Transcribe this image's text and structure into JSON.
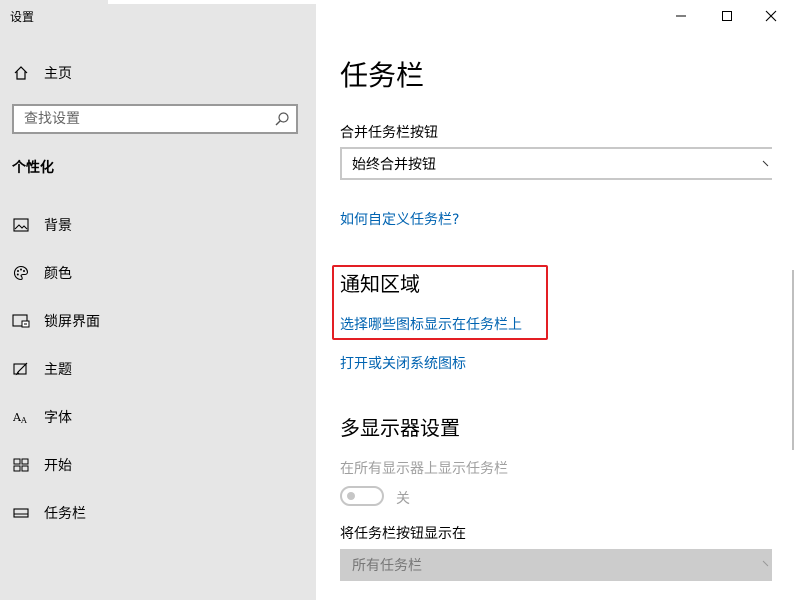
{
  "app": {
    "title": "设置"
  },
  "window": {
    "min_icon": "minimize-icon",
    "max_icon": "maximize-icon",
    "close_icon": "close-icon"
  },
  "sidebar": {
    "home_label": "主页",
    "search_placeholder": "查找设置",
    "section_label": "个性化",
    "items": [
      {
        "label": "背景",
        "icon": "image-icon"
      },
      {
        "label": "颜色",
        "icon": "palette-icon"
      },
      {
        "label": "锁屏界面",
        "icon": "lock-screen-icon"
      },
      {
        "label": "主题",
        "icon": "theme-icon"
      },
      {
        "label": "字体",
        "icon": "font-icon"
      },
      {
        "label": "开始",
        "icon": "start-icon"
      },
      {
        "label": "任务栏",
        "icon": "taskbar-icon"
      }
    ]
  },
  "main": {
    "title": "任务栏",
    "combine_label": "合并任务栏按钮",
    "combine_value": "始终合并按钮",
    "customize_link": "如何自定义任务栏?",
    "notification_heading": "通知区域",
    "select_icons_link": "选择哪些图标显示在任务栏上",
    "system_icons_link": "打开或关闭系统图标",
    "multi_display_heading": "多显示器设置",
    "show_all_label": "在所有显示器上显示任务栏",
    "toggle_state": "关",
    "show_buttons_label": "将任务栏按钮显示在",
    "show_buttons_value": "所有任务栏"
  },
  "colors": {
    "link": "#0063b1",
    "highlight": "#e31e24"
  }
}
